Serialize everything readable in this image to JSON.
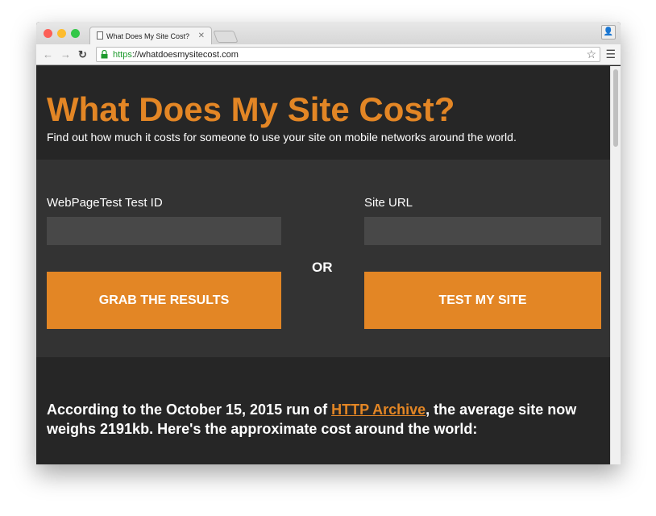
{
  "browser": {
    "tab_title": "What Does My Site Cost?",
    "url_scheme": "https",
    "url_rest": "://whatdoesmysitecost.com"
  },
  "hero": {
    "title": "What Does My Site Cost?",
    "subtitle": "Find out how much it costs for someone to use your site on mobile networks around the world."
  },
  "form": {
    "test_id_label": "WebPageTest Test ID",
    "test_id_value": "",
    "site_url_label": "Site URL",
    "site_url_value": "",
    "or_label": "OR",
    "grab_button": "GRAB THE RESULTS",
    "test_button": "TEST MY SITE"
  },
  "info": {
    "prefix": "According to the October 15, 2015 run of ",
    "link": "HTTP Archive",
    "suffix": ", the average site now weighs 2191kb. Here's the approximate cost around the world:"
  },
  "colors": {
    "accent": "#e38625",
    "background": "#262626",
    "panel": "#333333"
  }
}
